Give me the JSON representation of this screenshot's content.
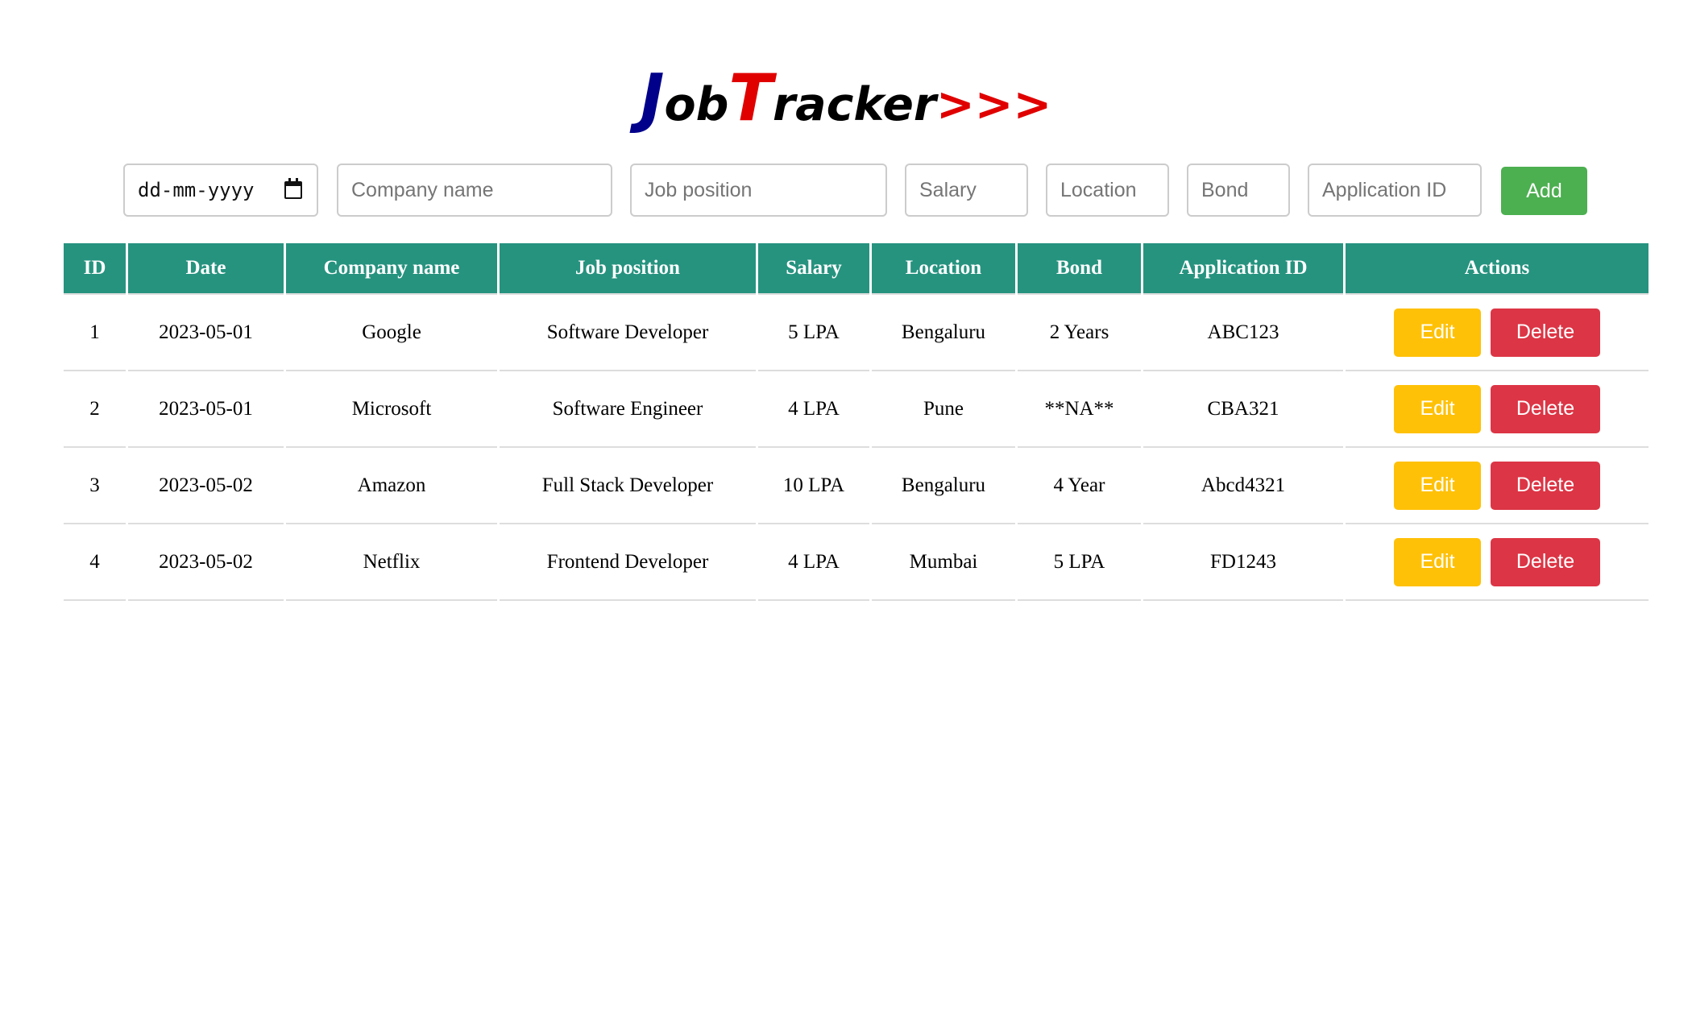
{
  "logo": {
    "j": "J",
    "ob": "ob",
    "t": "T",
    "racker": "racker",
    "arrows": ">>>"
  },
  "form": {
    "date_placeholder": "dd-mm-yyyy",
    "company_placeholder": "Company name",
    "position_placeholder": "Job position",
    "salary_placeholder": "Salary",
    "location_placeholder": "Location",
    "bond_placeholder": "Bond",
    "appid_placeholder": "Application ID",
    "add_label": "Add"
  },
  "table": {
    "headers": [
      "ID",
      "Date",
      "Company name",
      "Job position",
      "Salary",
      "Location",
      "Bond",
      "Application ID",
      "Actions"
    ],
    "rows": [
      {
        "id": "1",
        "date": "2023-05-01",
        "company": "Google",
        "position": "Software Developer",
        "salary": "5 LPA",
        "location": "Bengaluru",
        "bond": "2 Years",
        "app_id": "ABC123"
      },
      {
        "id": "2",
        "date": "2023-05-01",
        "company": "Microsoft",
        "position": "Software Engineer",
        "salary": "4 LPA",
        "location": "Pune",
        "bond": "**NA**",
        "app_id": "CBA321"
      },
      {
        "id": "3",
        "date": "2023-05-02",
        "company": "Amazon",
        "position": "Full Stack Developer",
        "salary": "10 LPA",
        "location": "Bengaluru",
        "bond": "4 Year",
        "app_id": "Abcd4321"
      },
      {
        "id": "4",
        "date": "2023-05-02",
        "company": "Netflix",
        "position": "Frontend Developer",
        "salary": "4 LPA",
        "location": "Mumbai",
        "bond": "5 LPA",
        "app_id": "FD1243"
      }
    ],
    "edit_label": "Edit",
    "delete_label": "Delete"
  },
  "colors": {
    "header_bg": "#26937f",
    "add_button": "#4caf50",
    "edit_button": "#ffc107",
    "delete_button": "#dc3545",
    "logo_blue": "#00008b",
    "logo_red": "#e00000"
  }
}
